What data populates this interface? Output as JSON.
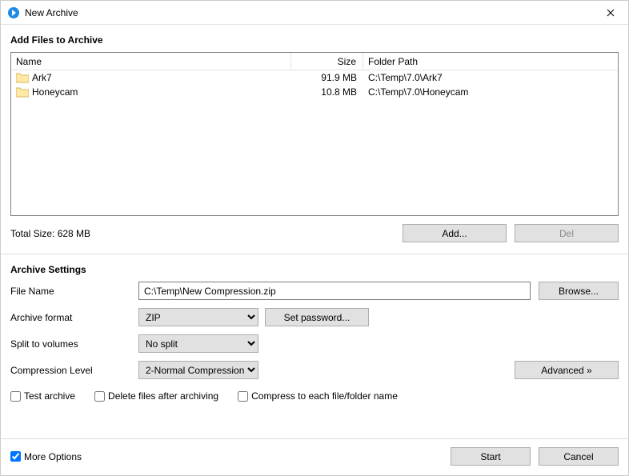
{
  "window": {
    "title": "New Archive"
  },
  "addFiles": {
    "heading": "Add Files to Archive",
    "columns": {
      "name": "Name",
      "size": "Size",
      "path": "Folder Path"
    },
    "rows": [
      {
        "name": "Ark7",
        "size": "91.9 MB",
        "path": "C:\\Temp\\7.0\\Ark7"
      },
      {
        "name": "Honeycam",
        "size": "10.8 MB",
        "path": "C:\\Temp\\7.0\\Honeycam"
      }
    ],
    "totalSize": "Total Size: 628 MB",
    "addLabel": "Add...",
    "delLabel": "Del"
  },
  "settings": {
    "heading": "Archive Settings",
    "fileNameLabel": "File Name",
    "fileNameValue": "C:\\Temp\\New Compression.zip",
    "browseLabel": "Browse...",
    "formatLabel": "Archive format",
    "formatValue": "ZIP",
    "setPasswordLabel": "Set password...",
    "splitLabel": "Split to volumes",
    "splitValue": "No split",
    "levelLabel": "Compression Level",
    "levelValue": "2-Normal Compression",
    "advancedLabel": "Advanced »",
    "checkTest": "Test archive",
    "checkDelete": "Delete files after archiving",
    "checkEach": "Compress to each file/folder name"
  },
  "footer": {
    "moreOptions": "More Options",
    "start": "Start",
    "cancel": "Cancel"
  }
}
